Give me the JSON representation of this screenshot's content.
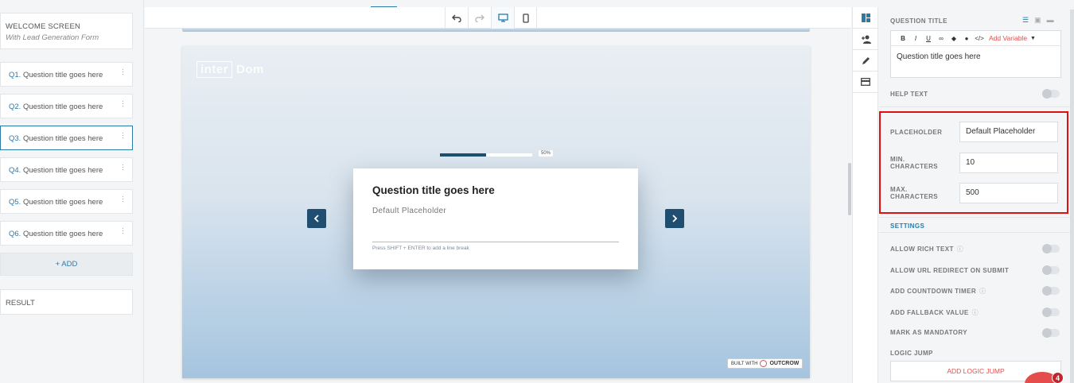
{
  "sidebar": {
    "welcome": {
      "title": "WELCOME SCREEN",
      "subtitle": "With Lead Generation Form"
    },
    "questions": [
      {
        "num": "Q1.",
        "label": "Question title goes here"
      },
      {
        "num": "Q2.",
        "label": "Question title goes here"
      },
      {
        "num": "Q3.",
        "label": "Question title goes here"
      },
      {
        "num": "Q4.",
        "label": "Question title goes here"
      },
      {
        "num": "Q5.",
        "label": "Question title goes here"
      },
      {
        "num": "Q6.",
        "label": "Question title goes here"
      }
    ],
    "active_question_index": 2,
    "add_label": "+ ADD",
    "result_label": "RESULT"
  },
  "toolbar": {
    "undo_icon": "undo-icon",
    "redo_icon": "redo-icon",
    "desktop_icon": "desktop-icon",
    "mobile_icon": "mobile-icon",
    "active_view": "desktop"
  },
  "preview": {
    "logo_box": "inter",
    "logo_rest": "Dom",
    "progress_fraction": 0.5,
    "progress_label": "50%",
    "question_title": "Question title goes here",
    "placeholder": "Default Placeholder",
    "hint": "Press SHIFT + ENTER to add a line break",
    "built_with": "BUILT WITH",
    "built_brand": "OUTCROW"
  },
  "right_panel": {
    "question_title_label": "QUESTION TITLE",
    "editor_buttons": [
      "B",
      "I",
      "U",
      "🔗",
      "⬟",
      "💧",
      "</>"
    ],
    "add_variable": "Add Variable",
    "question_text": "Question title goes here",
    "help_text_label": "HELP TEXT",
    "placeholder_label": "PLACEHOLDER",
    "placeholder_value": "Default Placeholder",
    "min_label_1": "MIN.",
    "min_label_2": "CHARACTERS",
    "min_value": "10",
    "max_label_1": "MAX.",
    "max_label_2": "CHARACTERS",
    "max_value": "500",
    "settings_label": "SETTINGS",
    "settings": [
      {
        "label": "ALLOW RICH TEXT",
        "info": true
      },
      {
        "label": "ALLOW URL REDIRECT ON SUBMIT",
        "info": false
      },
      {
        "label": "ADD COUNTDOWN TIMER",
        "info": true
      },
      {
        "label": "ADD FALLBACK VALUE",
        "info": true
      },
      {
        "label": "MARK AS MANDATORY",
        "info": false
      }
    ],
    "logic_jump_label": "LOGIC JUMP",
    "add_logic_jump": "ADD LOGIC JUMP",
    "notification_count": "4"
  },
  "colors": {
    "accent": "#2b7ba8",
    "nav_dark": "#1f4e70",
    "highlight_red": "#e01010",
    "link_red": "#e54d4d"
  }
}
